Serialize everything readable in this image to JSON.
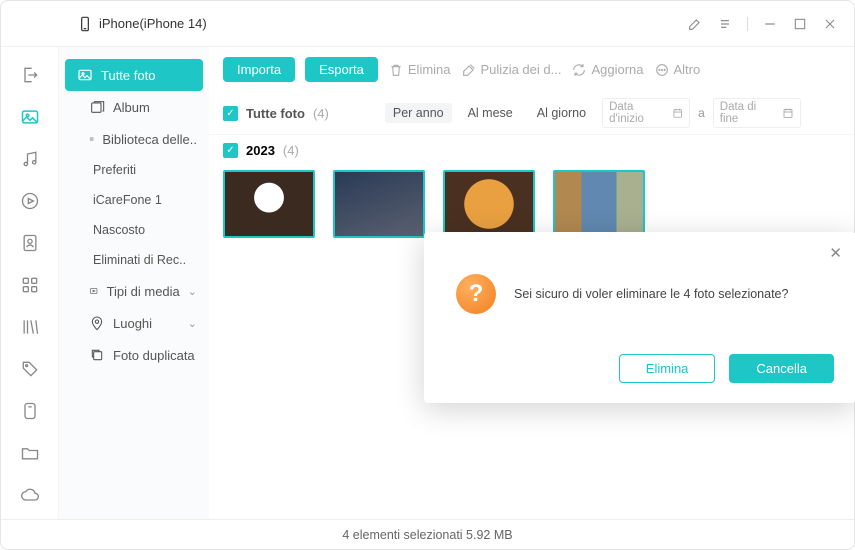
{
  "titlebar": {
    "device_name": "iPhone(iPhone 14)"
  },
  "rail": {
    "items": [
      {
        "name": "exit-icon"
      },
      {
        "name": "photos-icon"
      },
      {
        "name": "music-icon"
      },
      {
        "name": "videos-icon"
      },
      {
        "name": "contacts-icon"
      },
      {
        "name": "apps-icon"
      },
      {
        "name": "books-icon"
      },
      {
        "name": "tags-icon"
      },
      {
        "name": "storage-icon"
      },
      {
        "name": "folder-icon"
      },
      {
        "name": "cloud-icon"
      }
    ]
  },
  "sidebar": {
    "all_photos": "Tutte foto",
    "album": "Album",
    "library": "Biblioteca delle..",
    "favorites": "Preferiti",
    "icarefone": "iCareFone 1",
    "hidden": "Nascosto",
    "deleted": "Eliminati di Rec..",
    "media_type": "Tipi di media",
    "places": "Luoghi",
    "duplicate": "Foto duplicata"
  },
  "toolbar": {
    "import": "Importa",
    "export": "Esporta",
    "delete": "Elimina",
    "clean": "Pulizia dei d...",
    "refresh": "Aggiorna",
    "more": "Altro"
  },
  "filter": {
    "all_label": "Tutte foto",
    "all_count": "(4)",
    "per_year": "Per anno",
    "per_month": "Al mese",
    "per_day": "Al giorno",
    "date_start_ph": "Data d'inizio",
    "to": "a",
    "date_end_ph": "Data di fine"
  },
  "group": {
    "year": "2023",
    "count": "(4)"
  },
  "dialog": {
    "message": "Sei sicuro di voler eliminare le 4 foto selezionate?",
    "delete": "Elimina",
    "cancel": "Cancella"
  },
  "status": {
    "text": "4 elementi selezionati 5.92 MB"
  }
}
